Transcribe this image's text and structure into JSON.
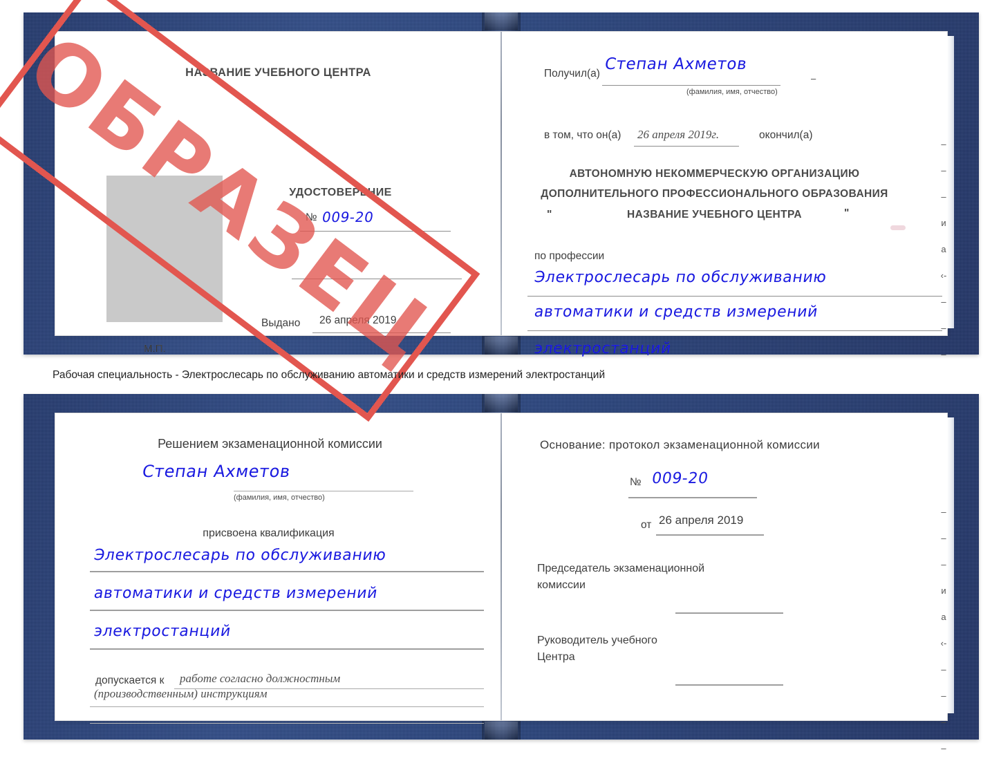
{
  "caption": "Рабочая специальность - Электрослесарь по обслуживанию автоматики и средств измерений электростанций",
  "watermark": {
    "text": "ОБРАЗЕЦ",
    "color": "#e2564f"
  },
  "colors": {
    "cover": "#24407f",
    "handwriting": "#1a1ae0",
    "print": "#3e3e3e",
    "photo_placeholder": "#c9c9c9",
    "rule": "#8d8d8d"
  },
  "cert_top": {
    "left_page": {
      "center_name": "НАЗВАНИЕ УЧЕБНОГО ЦЕНТРА",
      "doc_title": "УДОСТОВЕРЕНИЕ",
      "number_label": "№",
      "number_value": "009-20",
      "issued_label": "Выдано",
      "issued_value": "26 апреля 2019",
      "seal_label": "М.П.",
      "photo_placeholder": "photo-box"
    },
    "right_page": {
      "received_label": "Получил(а)",
      "received_value": "Степан Ахметов",
      "fio_hint": "(фамилия, имя, отчество)",
      "that_he_label": "в том, что он(а)",
      "that_he_value": "26 апреля 2019г.",
      "finished_label": "окончил(а)",
      "org_line1": "АВТОНОМНУЮ НЕКОММЕРЧЕСКУЮ ОРГАНИЗАЦИЮ",
      "org_line2": "ДОПОЛНИТЕЛЬНОГО ПРОФЕССИОНАЛЬНОГО ОБРАЗОВАНИЯ",
      "org_quote_open": "\"",
      "org_line3": "НАЗВАНИЕ УЧЕБНОГО ЦЕНТРА",
      "org_quote_close": "\"",
      "profession_label": "по профессии",
      "profession_line1": "Электрослесарь по обслуживанию",
      "profession_line2": "автоматики и средств измерений",
      "profession_line3": "электростанций",
      "edge_glyphs": [
        "–",
        "–",
        "–",
        "и",
        "а",
        "‹-",
        "–",
        "–",
        "–"
      ]
    }
  },
  "cert_bottom": {
    "left_page": {
      "heading": "Решением экзаменационной комиссии",
      "name_value": "Степан Ахметов",
      "fio_hint": "(фамилия, имя, отчество)",
      "qualification_label": "присвоена квалификация",
      "qualification_line1": "Электрослесарь по обслуживанию",
      "qualification_line2": "автоматики и средств измерений",
      "qualification_line3": "электростанций",
      "admitted_label": "допускается к",
      "admitted_line1": "работе согласно должностным",
      "admitted_line2": "(производственным) инструкциям"
    },
    "right_page": {
      "basis_label": "Основание: протокол экзаменационной комиссии",
      "number_label": "№",
      "number_value": "009-20",
      "date_label": "от",
      "date_value": "26 апреля 2019",
      "chairman_line1": "Председатель экзаменационной",
      "chairman_line2": "комиссии",
      "head_line1": "Руководитель учебного",
      "head_line2": "Центра",
      "edge_glyphs": [
        "–",
        "–",
        "–",
        "и",
        "а",
        "‹-",
        "–",
        "–",
        "–",
        "–"
      ]
    }
  }
}
